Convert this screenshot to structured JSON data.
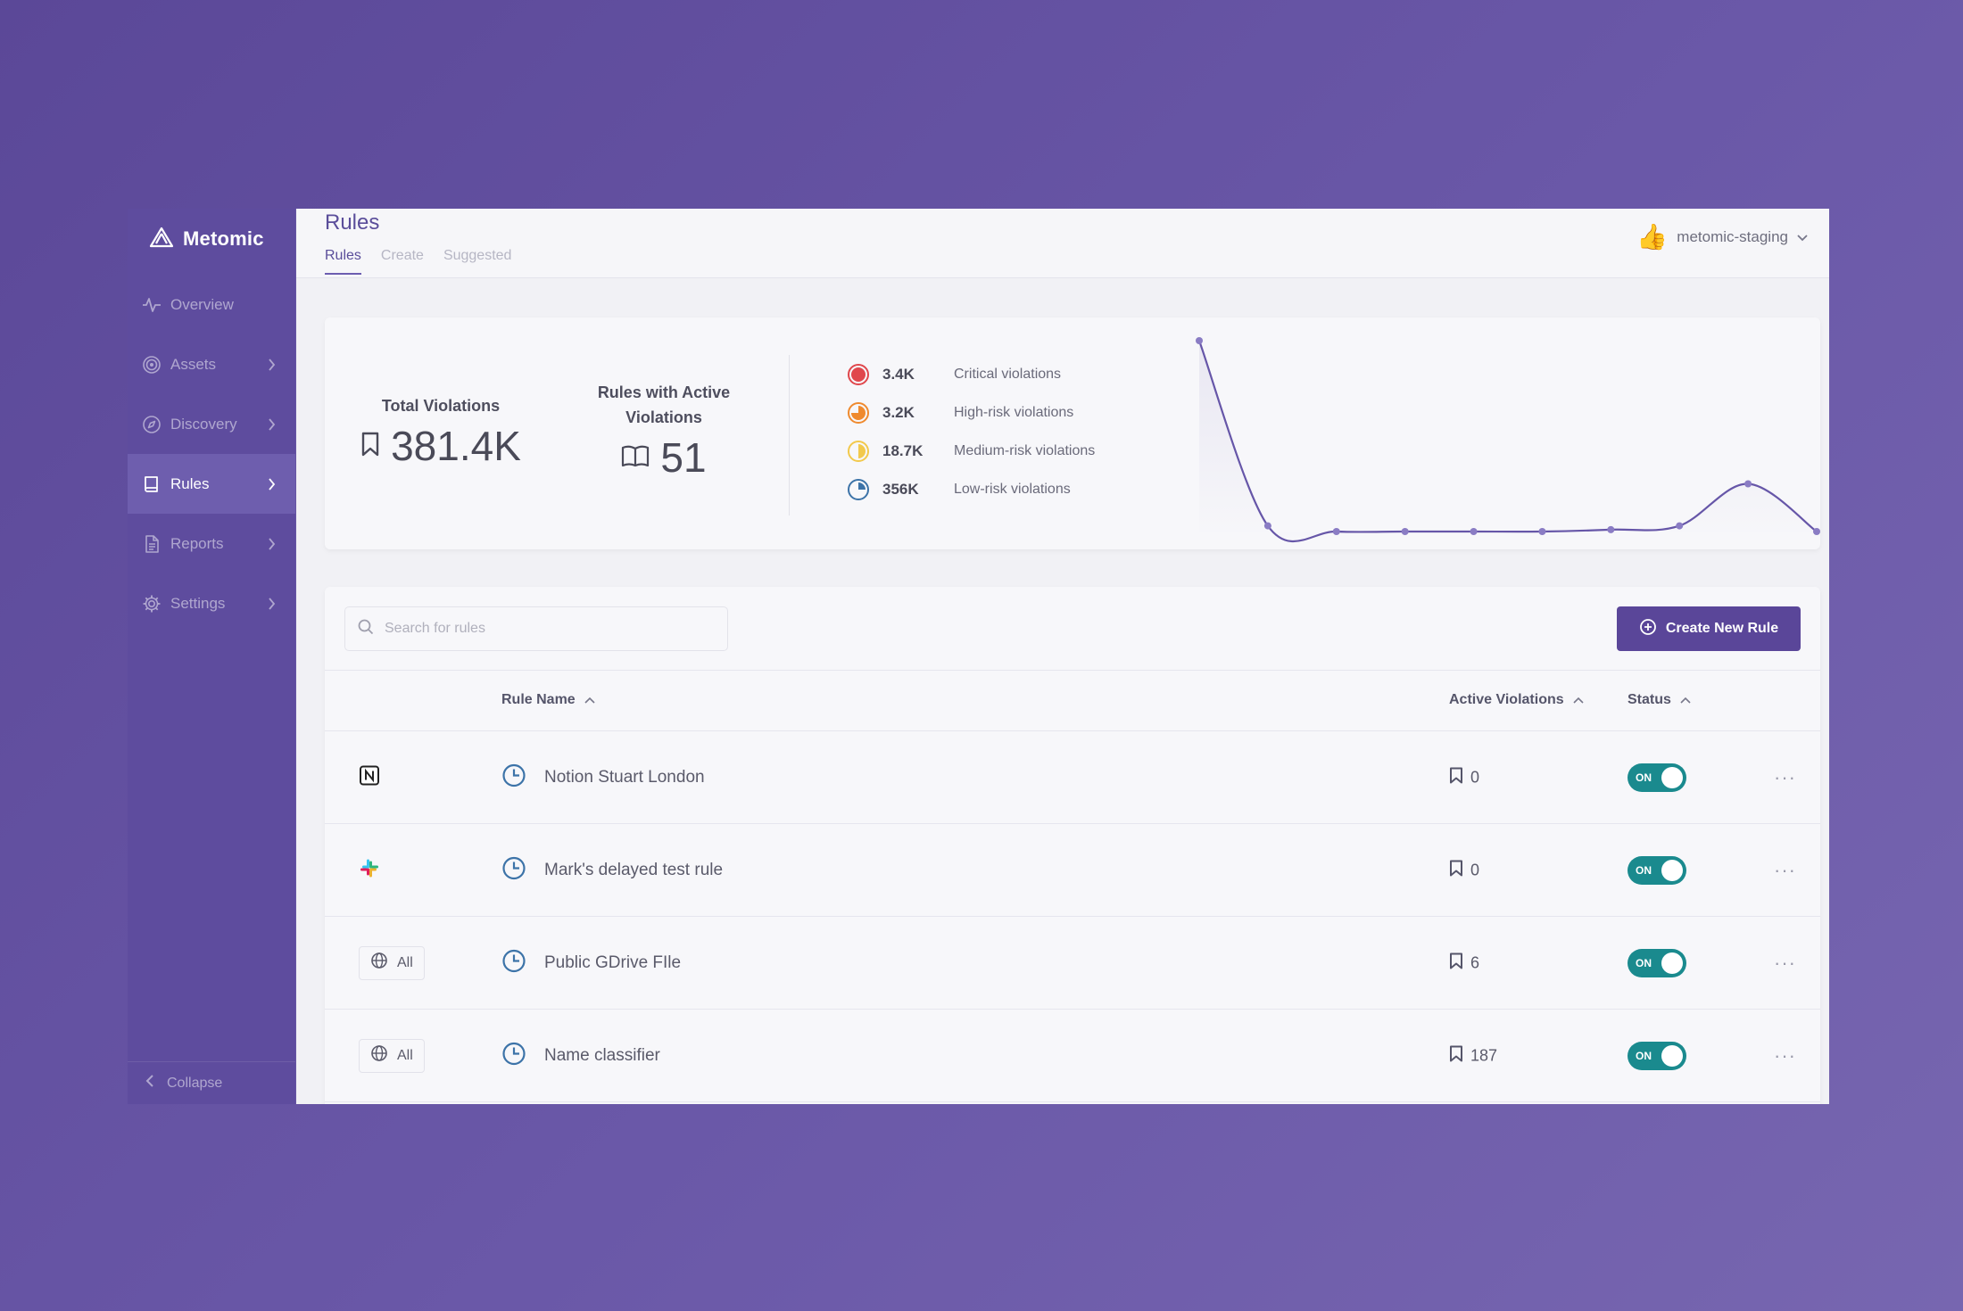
{
  "app": {
    "name": "Metomic"
  },
  "sidebar": {
    "items": [
      {
        "label": "Overview",
        "icon": "activity-icon",
        "has_chevron": false,
        "active": false
      },
      {
        "label": "Assets",
        "icon": "target-icon",
        "has_chevron": true,
        "active": false
      },
      {
        "label": "Discovery",
        "icon": "compass-icon",
        "has_chevron": true,
        "active": false
      },
      {
        "label": "Rules",
        "icon": "book-icon",
        "has_chevron": true,
        "active": true
      },
      {
        "label": "Reports",
        "icon": "document-icon",
        "has_chevron": true,
        "active": false
      },
      {
        "label": "Settings",
        "icon": "gear-icon",
        "has_chevron": true,
        "active": false
      }
    ],
    "collapse_label": "Collapse"
  },
  "header": {
    "title": "Rules",
    "tabs": [
      {
        "label": "Rules",
        "active": true
      },
      {
        "label": "Create",
        "active": false
      },
      {
        "label": "Suggested",
        "active": false
      }
    ],
    "account": {
      "name": "metomic-staging",
      "icon": "thumbs-up-icon"
    }
  },
  "stats": {
    "total_violations": {
      "label": "Total Violations",
      "value": "381.4K"
    },
    "rules_active": {
      "label_line1": "Rules with Active",
      "label_line2": "Violations",
      "value": "51"
    },
    "risks": [
      {
        "count": "3.4K",
        "label": "Critical violations",
        "color": "#e0474c",
        "level": "critical"
      },
      {
        "count": "3.2K",
        "label": "High-risk violations",
        "color": "#ef8a2e",
        "level": "high"
      },
      {
        "count": "18.7K",
        "label": "Medium-risk violations",
        "color": "#f2c94c",
        "level": "medium"
      },
      {
        "count": "356K",
        "label": "Low-risk violations",
        "color": "#3c73a8",
        "level": "low"
      }
    ]
  },
  "chart_data": {
    "type": "line",
    "title": "",
    "xlabel": "",
    "ylabel": "",
    "series": [
      {
        "values": [
          100,
          3,
          0,
          0,
          0,
          0,
          1,
          3,
          25,
          0
        ]
      }
    ],
    "ylim": [
      0,
      100
    ],
    "grid": false,
    "color": "#6656a8"
  },
  "rules": {
    "search_placeholder": "Search for rules",
    "create_button_label": "Create New Rule",
    "columns": {
      "name": "Rule Name",
      "violations": "Active Violations",
      "status": "Status"
    },
    "rows": [
      {
        "source": "notion",
        "source_label": "",
        "name": "Notion Stuart London",
        "violations": "0",
        "status": "ON"
      },
      {
        "source": "slack",
        "source_label": "",
        "name": "Mark's delayed test rule",
        "violations": "0",
        "status": "ON"
      },
      {
        "source": "all",
        "source_label": "All",
        "name": "Public GDrive FIle",
        "violations": "6",
        "status": "ON"
      },
      {
        "source": "all",
        "source_label": "All",
        "name": "Name classifier",
        "violations": "187",
        "status": "ON"
      }
    ]
  },
  "colors": {
    "accent": "#5a4699",
    "sidebar": "#5e4c9e",
    "toggle_on": "#1a8a8e"
  }
}
